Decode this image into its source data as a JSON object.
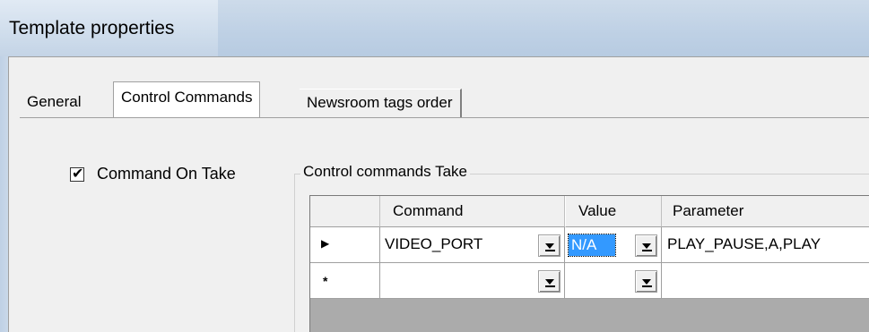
{
  "window": {
    "title": "Template properties"
  },
  "tabs": [
    {
      "label": "General",
      "active": false
    },
    {
      "label": "Control Commands",
      "active": true
    },
    {
      "label": "Newsroom tags order",
      "active": false
    }
  ],
  "command_on_take": {
    "label": "Command On Take",
    "checked": true
  },
  "group": {
    "title": "Control commands Take",
    "columns": [
      "Command",
      "Value",
      "Parameter"
    ],
    "rows": [
      {
        "command": "VIDEO_PORT",
        "value": "N/A",
        "parameter": "PLAY_PAUSE,A,PLAY"
      },
      {
        "command": "",
        "value": "",
        "parameter": ""
      }
    ]
  },
  "colors": {
    "titlebar": "#bfd1e5",
    "selection": "#3399ff",
    "grid_empty": "#ababab"
  }
}
